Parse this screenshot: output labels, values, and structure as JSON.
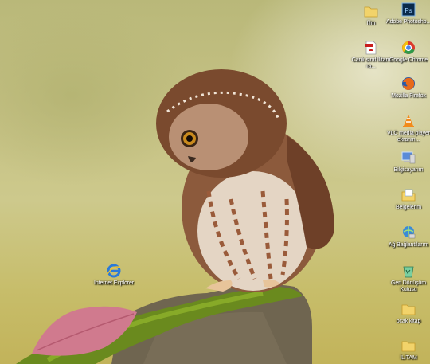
{
  "desktop": {
    "wallpaper": {
      "subject": "owl on mossy rock",
      "accent": "#8b5a3a"
    },
    "icons": [
      {
        "label": "film",
        "icon": "folder-icon"
      },
      {
        "label": "Adobe Photosho...",
        "icon": "photoshop-icon"
      },
      {
        "label": "Canlı sınıf İlitam ra...",
        "icon": "pdf-icon"
      },
      {
        "label": "Google Chrome",
        "icon": "chrome-icon"
      },
      {
        "label": "Mozilla Firefox",
        "icon": "firefox-icon"
      },
      {
        "label": "VLC media player ekranın...",
        "icon": "vlc-icon"
      },
      {
        "label": "Bilgisayarım",
        "icon": "computer-icon"
      },
      {
        "label": "Belgelerim",
        "icon": "documents-icon"
      },
      {
        "label": "Ağ Bağlantılarım",
        "icon": "network-icon"
      },
      {
        "label": "Geri Dönüşüm Kutusu",
        "icon": "recycle-bin-icon"
      },
      {
        "label": "ocak kitap",
        "icon": "folder-icon"
      },
      {
        "label": "İLİTAM",
        "icon": "folder-icon"
      },
      {
        "label": "Internet Explorer",
        "icon": "internet-explorer-icon"
      }
    ]
  }
}
